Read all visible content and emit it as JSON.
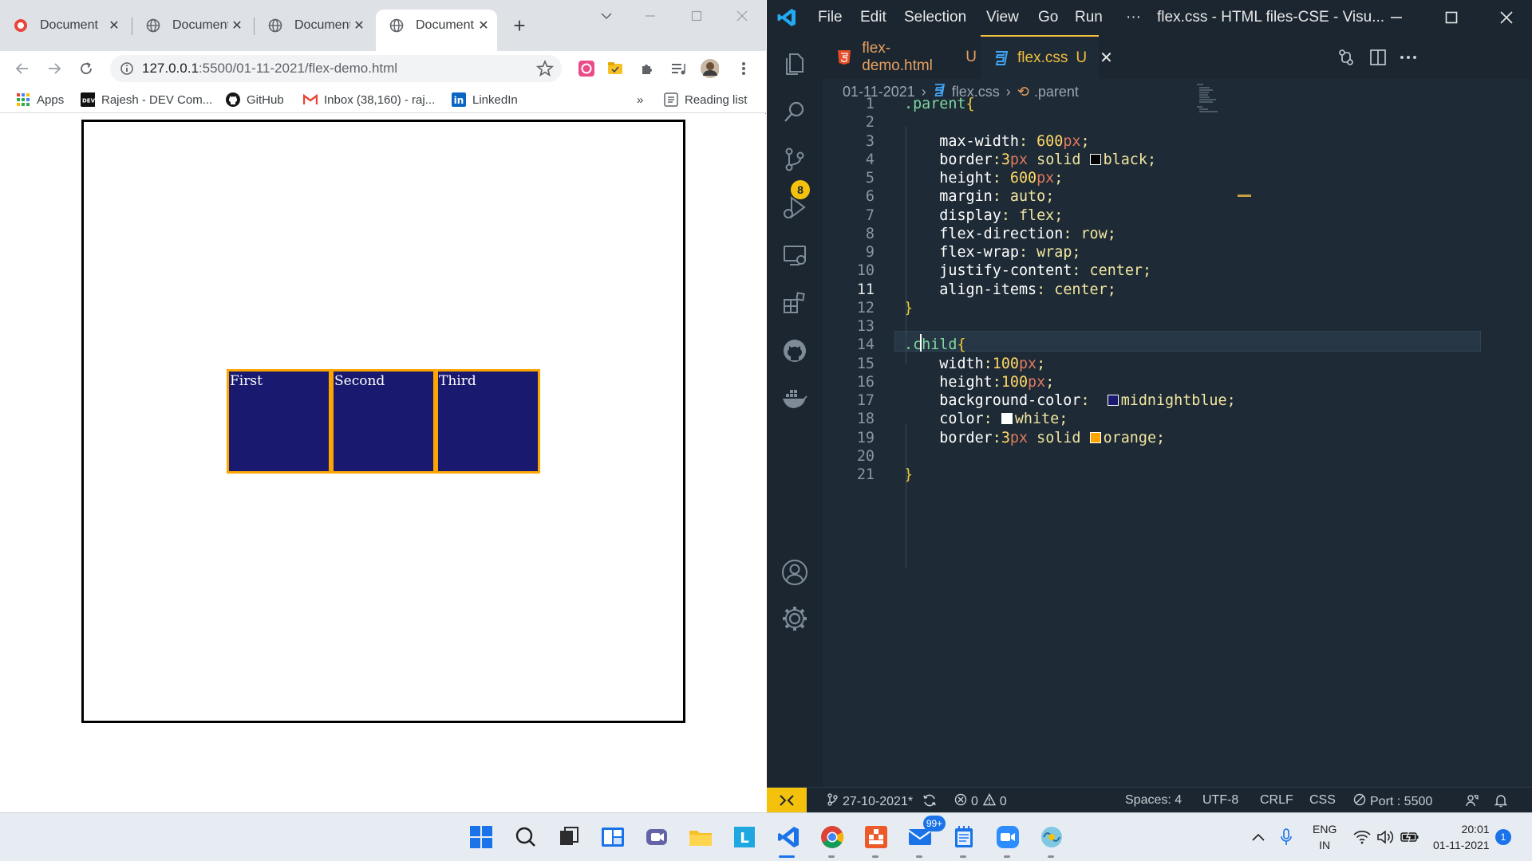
{
  "browser": {
    "tabs": [
      {
        "label": "Document",
        "favicon": "app-icon"
      },
      {
        "label": "Document",
        "favicon": "globe-icon"
      },
      {
        "label": "Document",
        "favicon": "globe-icon"
      },
      {
        "label": "Document",
        "favicon": "globe-icon"
      }
    ],
    "address": {
      "host": "127.0.0.1",
      "rest": ":5500/01-11-2021/flex-demo.html"
    },
    "bookmarks": [
      {
        "label": "Apps",
        "icon": "apps-grid-icon"
      },
      {
        "label": "Rajesh - DEV Com...",
        "icon": "dev-icon"
      },
      {
        "label": "GitHub",
        "icon": "github-icon"
      },
      {
        "label": "Inbox (38,160) - raj...",
        "icon": "gmail-icon"
      },
      {
        "label": "LinkedIn",
        "icon": "linkedin-icon"
      }
    ],
    "bookmarks_more": "»",
    "reading_list": "Reading list",
    "page": {
      "children": [
        "First",
        "Second",
        "Third"
      ]
    }
  },
  "vscode": {
    "menu": [
      "File",
      "Edit",
      "Selection",
      "View",
      "Go",
      "Run",
      "···"
    ],
    "window_title": "flex.css - HTML files-CSE - Visu...",
    "tabs": [
      {
        "label": "flex-demo.html",
        "status": "U",
        "icon": "html5-icon"
      },
      {
        "label": "flex.css",
        "status": "U",
        "icon": "css3-icon"
      }
    ],
    "breadcrumb": [
      "01-11-2021",
      "flex.css",
      ".parent"
    ],
    "line_numbers": [
      "1",
      "2",
      "3",
      "4",
      "5",
      "6",
      "7",
      "8",
      "9",
      "10",
      "11",
      "12",
      "13",
      "14",
      "15",
      "16",
      "17",
      "18",
      "19",
      "20",
      "21"
    ],
    "code": {
      "parent_selector": ".parent",
      "child_selector": ".child",
      "open_brace": "{",
      "close_brace": "}",
      "parent_props": [
        {
          "prop": "max-width",
          "num": "600",
          "unit": "px"
        },
        {
          "prop": "border",
          "num": "3",
          "unit": "px",
          "rest": "solid",
          "color": "black"
        },
        {
          "prop": "height",
          "num": "600",
          "unit": "px"
        },
        {
          "prop": "margin",
          "val": "auto"
        },
        {
          "prop": "display",
          "val": "flex"
        },
        {
          "prop": "flex-direction",
          "val": "row"
        },
        {
          "prop": "flex-wrap",
          "val": "wrap"
        },
        {
          "prop": "justify-content",
          "val": "center"
        },
        {
          "prop": "align-items",
          "val": "center"
        }
      ],
      "child_props": [
        {
          "prop": "width",
          "num": "100",
          "unit": "px"
        },
        {
          "prop": "height",
          "num": "100",
          "unit": "px"
        },
        {
          "prop": "background-color",
          "color": "midnightblue"
        },
        {
          "prop": "color",
          "color": "white"
        },
        {
          "prop": "border",
          "num": "3",
          "unit": "px",
          "rest": "solid",
          "color": "orange"
        }
      ]
    },
    "scm_badge": "8",
    "status": {
      "branch": "27-10-2021*",
      "errors": "0",
      "warnings": "0",
      "spaces": "Spaces: 4",
      "encoding": "UTF-8",
      "eol": "CRLF",
      "language": "CSS",
      "port": "Port : 5500"
    }
  },
  "taskbar": {
    "mail_badge": "99+",
    "lang_top": "ENG",
    "lang_bottom": "IN",
    "time": "20:01",
    "date": "01-11-2021",
    "notifications": "1"
  },
  "colors": {
    "editor_bg": "#1e2a35",
    "accent": "#f4c20d",
    "child_bg": "#191970",
    "child_border": "#ffa500"
  }
}
